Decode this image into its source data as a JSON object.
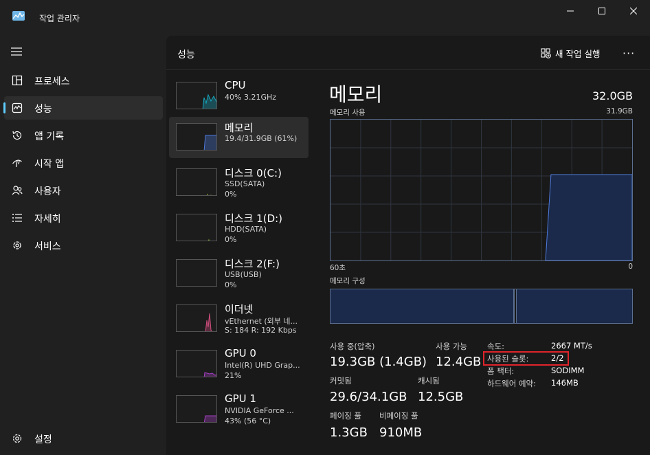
{
  "window": {
    "title": "작업 관리자"
  },
  "nav": {
    "items": [
      {
        "label": "프로세스",
        "icon": "processes-icon"
      },
      {
        "label": "성능",
        "icon": "performance-icon",
        "active": true
      },
      {
        "label": "앱 기록",
        "icon": "app-history-icon"
      },
      {
        "label": "시작 앱",
        "icon": "startup-apps-icon"
      },
      {
        "label": "사용자",
        "icon": "users-icon"
      },
      {
        "label": "자세히",
        "icon": "details-icon"
      },
      {
        "label": "서비스",
        "icon": "services-icon"
      }
    ],
    "settings_label": "설정"
  },
  "header": {
    "title": "성능",
    "run_task": "새 작업 실행",
    "more": "···"
  },
  "resources": [
    {
      "name": "CPU",
      "sub1": "40% 3.21GHz",
      "sub2": "",
      "color": "#17a9c0"
    },
    {
      "name": "메모리",
      "sub1": "19.4/31.9GB (61%)",
      "sub2": "",
      "color": "#4e7bdc",
      "selected": true
    },
    {
      "name": "디스크 0(C:)",
      "sub1": "SSD(SATA)",
      "sub2": "0%",
      "color": "#8bb33a"
    },
    {
      "name": "디스크 1(D:)",
      "sub1": "HDD(SATA)",
      "sub2": "0%",
      "color": "#8bb33a"
    },
    {
      "name": "디스크 2(F:)",
      "sub1": "USB(USB)",
      "sub2": "0%",
      "color": "#8bb33a"
    },
    {
      "name": "이더넷",
      "sub1": "vEthernet (외부 네...",
      "sub2": "S: 184 R: 192 Kbps",
      "color": "#d14e7e"
    },
    {
      "name": "GPU 0",
      "sub1": "Intel(R) UHD Grap...",
      "sub2": "21%",
      "color": "#a640c4"
    },
    {
      "name": "GPU 1",
      "sub1": "NVIDIA GeForce ...",
      "sub2": "43% (56 °C)",
      "color": "#a640c4"
    }
  ],
  "detail": {
    "title": "메모리",
    "capacity": "32.0GB",
    "graph_label": "메모리 사용",
    "graph_max": "31.9GB",
    "graph_left": "60초",
    "graph_right": "0",
    "composition_label": "메모리 구성",
    "usage_fraction": 0.61,
    "stats": {
      "in_use_label": "사용 중(압축)",
      "in_use_value": "19.3GB (1.4GB)",
      "available_label": "사용 가능",
      "available_value": "12.4GB",
      "committed_label": "커밋됨",
      "committed_value": "29.6/34.1GB",
      "cached_label": "캐시됨",
      "cached_value": "12.5GB",
      "paged_label": "페이징 풀",
      "paged_value": "1.3GB",
      "nonpaged_label": "비페이징 풀",
      "nonpaged_value": "910MB"
    },
    "props": {
      "speed_key": "속도:",
      "speed_val": "2667 MT/s",
      "slots_key": "사용된 슬롯:",
      "slots_val": "2/2",
      "form_key": "폼 팩터:",
      "form_val": "SODIMM",
      "reserved_key": "하드웨어 예약:",
      "reserved_val": "146MB"
    }
  },
  "colors": {
    "accent": "#60cdff",
    "highlight": "#e0242b",
    "graph_fill": "#1b2a4a",
    "graph_line": "#4e7bdc"
  }
}
